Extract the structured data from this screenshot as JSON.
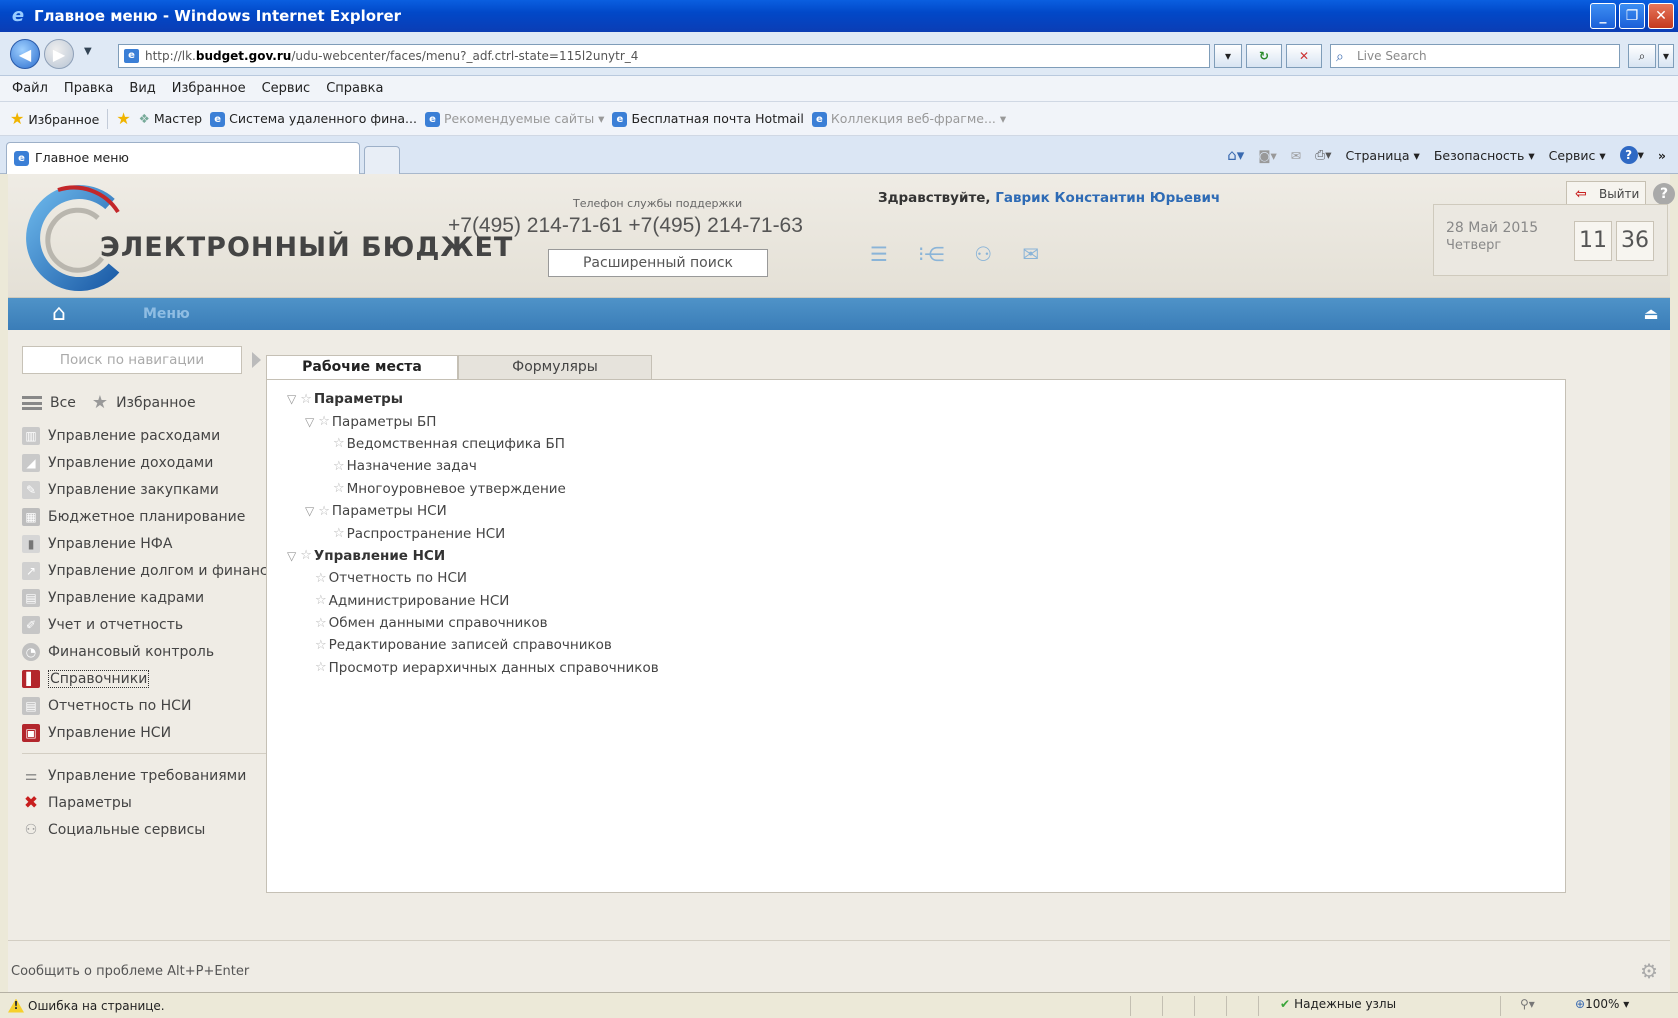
{
  "window": {
    "title": "Главное меню - Windows Internet Explorer"
  },
  "address": {
    "url_prefix": "http://lk.",
    "url_domain": "budget.gov.ru",
    "url_rest": "/udu-webcenter/faces/menu?_adf.ctrl-state=115l2unytr_4",
    "search_placeholder": "Live Search"
  },
  "menubar": [
    "Файл",
    "Правка",
    "Вид",
    "Избранное",
    "Сервис",
    "Справка"
  ],
  "favbar": {
    "favorites": "Избранное",
    "wizard": "Мастер",
    "link1": "Система удаленного фина...",
    "link2": "Рекомендуемые сайты ▾",
    "link3": "Бесплатная почта Hotmail",
    "link4": "Коллекция веб-фрагме... ▾"
  },
  "tab": {
    "label": "Главное меню"
  },
  "commands": {
    "page": "Страница ▾",
    "safety": "Безопасность ▾",
    "tools": "Сервис ▾"
  },
  "header": {
    "brand": "ЭЛЕКТРОННЫЙ БЮДЖЕТ",
    "support_label": "Телефон службы поддержки",
    "support_phones": "+7(495) 214-71-61 +7(495) 214-71-63",
    "advanced_search": "Расширенный поиск",
    "greeting": "Здравствуйте,",
    "user": "Гаврик Константин Юрьевич",
    "logout": "Выйти",
    "date": "28 Май 2015",
    "weekday": "Четверг",
    "hours": "11",
    "minutes": "36"
  },
  "nav": {
    "menu_label": "Меню"
  },
  "sidebar": {
    "search_placeholder": "Поиск по навигации",
    "all": "Все",
    "favorites": "Избранное",
    "items": [
      "Управление расходами",
      "Управление доходами",
      "Управление закупками",
      "Бюджетное планирование",
      "Управление НФА",
      "Управление долгом и финансовыми",
      "Управление кадрами",
      "Учет и отчетность",
      "Финансовый контроль",
      "Справочники",
      "Отчетность по НСИ",
      "Управление НСИ"
    ],
    "items2": [
      "Управление требованиями",
      "Параметры",
      "Социальные сервисы"
    ]
  },
  "content": {
    "tabs": [
      "Рабочие места",
      "Формуляры"
    ],
    "tree": [
      "Параметры",
      "Параметры БП",
      "Ведомственная специфика БП",
      "Назначение задач",
      "Многоуровневое утверждение",
      "Параметры НСИ",
      "Распространение НСИ",
      "Управление НСИ",
      "Отчетность по НСИ",
      "Администрирование НСИ",
      "Обмен данными справочников",
      "Редактирование записей справочников",
      "Просмотр иерархичных данных справочников"
    ]
  },
  "footer": {
    "report": "Сообщить о проблеме Alt+P+Enter"
  },
  "status": {
    "error": "Ошибка на странице.",
    "zone": "Надежные узлы",
    "zoom": "100%"
  }
}
